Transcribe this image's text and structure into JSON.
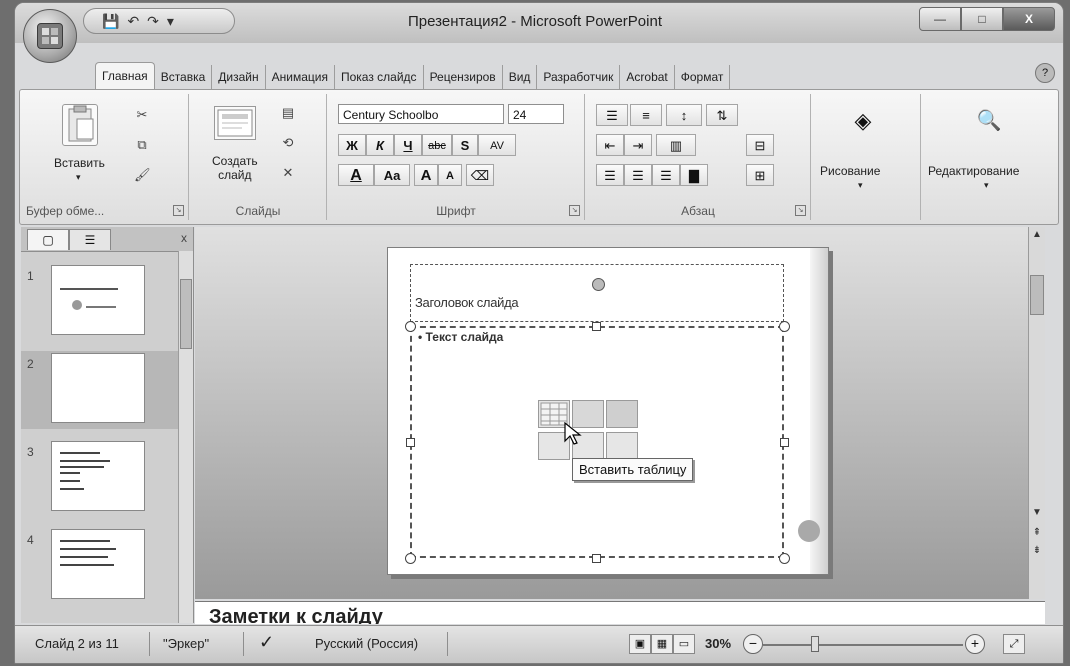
{
  "window": {
    "title": "Презентация2 - Microsoft PowerPoint",
    "controls": {
      "minimize": "—",
      "maximize": "□",
      "close": "X"
    }
  },
  "qat": {
    "save": "💾",
    "undo": "↶",
    "redo": "↷",
    "more": "▾"
  },
  "tabs": [
    "Главная",
    "Вставка",
    "Дизайн",
    "Анимация",
    "Показ слайдс",
    "Рецензиров",
    "Вид",
    "Разработчик",
    "Acrobat",
    "Формат"
  ],
  "ribbon": {
    "clipboard": {
      "paste_label": "Вставить",
      "group_label": "Буфер обме..."
    },
    "slides": {
      "new_slide_label": "Создать\nслайд",
      "group_label": "Слайды"
    },
    "font": {
      "font_name": "Century Schoolbo",
      "font_size": "24",
      "bold": "Ж",
      "italic": "К",
      "underline": "Ч",
      "strike": "abc",
      "shadow": "S",
      "spacing": "AV",
      "color": "A",
      "case": "Aa",
      "grow": "A",
      "shrink": "A",
      "clear": "",
      "group_label": "Шрифт"
    },
    "paragraph": {
      "group_label": "Абзац"
    },
    "drawing": {
      "label": "Рисование"
    },
    "editing": {
      "label": "Редактирование"
    }
  },
  "left_panel": {
    "tab_slides": "▢",
    "tab_outline": "☰",
    "close": "x",
    "slides": [
      {
        "num": "1"
      },
      {
        "num": "2"
      },
      {
        "num": "3"
      },
      {
        "num": "4"
      }
    ]
  },
  "slide": {
    "title_placeholder": "Заголовок слайда",
    "body_placeholder": "Текст слайда",
    "tooltip": "Вставить таблицу"
  },
  "notes": {
    "placeholder": "Заметки к слайду"
  },
  "status": {
    "slide_info": "Слайд 2 из 11",
    "theme": "\"Эркер\"",
    "language": "Русский (Россия)",
    "zoom": "30%"
  }
}
